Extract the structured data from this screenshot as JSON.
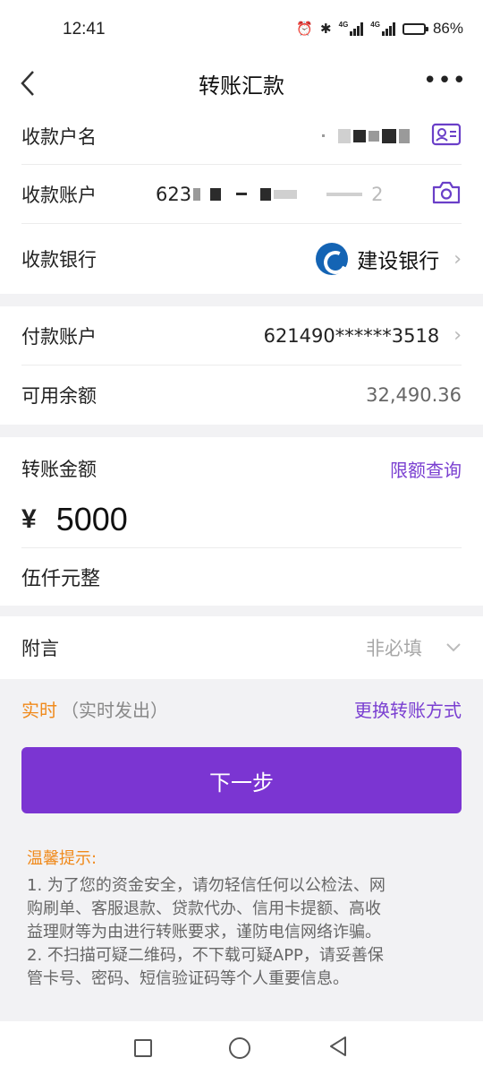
{
  "status_bar": {
    "time": "12:41",
    "network_tag_1": "4G",
    "network_tag_2": "4G",
    "battery_percent": "86%",
    "battery_level": 0.86
  },
  "nav": {
    "title": "转账汇款",
    "back_icon": "chevron-left-icon",
    "more_icon": "more-horizontal-icon"
  },
  "payee": {
    "name_label": "收款户名",
    "account_label": "收款账户",
    "account_prefix": "623",
    "account_suffix": "2",
    "bank_label": "收款银行",
    "bank_name": "建设银行"
  },
  "payer": {
    "account_label": "付款账户",
    "account_value": "621490******3518",
    "balance_label": "可用余额",
    "balance_value": "32,490.36"
  },
  "amount": {
    "label": "转账金额",
    "limit_link": "限额查询",
    "currency": "¥",
    "value": "5000",
    "words": "伍仟元整"
  },
  "note": {
    "label": "附言",
    "placeholder": "非必填"
  },
  "mode": {
    "main": "实时",
    "sub": "（实时发出）",
    "change_link": "更换转账方式"
  },
  "next_button": "下一步",
  "tips": {
    "title": "温馨提示:",
    "lines": [
      "1. 为了您的资金安全，请勿轻信任何以公检法、网",
      "购刷单、客服退款、贷款代办、信用卡提额、高收",
      "益理财等为由进行转账要求，谨防电信网络诈骗。",
      "2. 不扫描可疑二维码，不下载可疑APP，请妥善保",
      "管卡号、密码、短信验证码等个人重要信息。"
    ]
  },
  "colors": {
    "accent": "#7b35d2",
    "orange": "#f08a1c",
    "bank_blue": "#1464b4"
  }
}
